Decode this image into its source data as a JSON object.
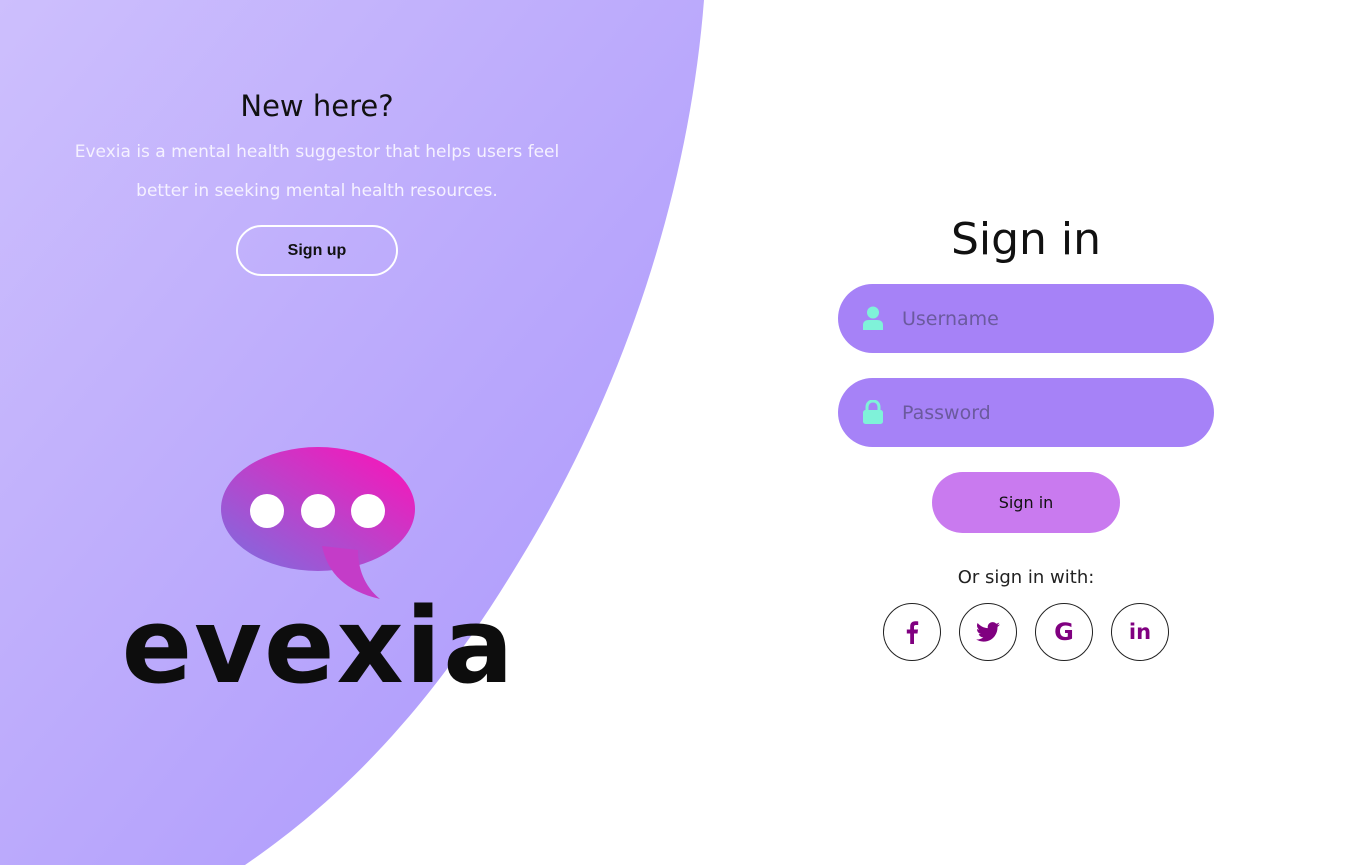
{
  "colors": {
    "panel_gradient_start": "#cdbffd",
    "panel_gradient_end": "#ab95fb",
    "field_bg": "#a682f7",
    "field_icon": "#7ff2d9",
    "signin_button": "#c97aef",
    "social_icon": "#800080",
    "logo_gradient_start": "#7a6fe0",
    "logo_gradient_end": "#ff10b8"
  },
  "left_panel": {
    "title": "New here?",
    "description": "Evexia is a mental health suggestor that helps users feel better in seeking mental health resources.",
    "signup_label": "Sign up"
  },
  "logo": {
    "wordmark": "evexia",
    "icon": "speech-bubble-icon"
  },
  "signin": {
    "title": "Sign in",
    "username_placeholder": "Username",
    "username_value": "",
    "username_icon": "user-icon",
    "password_placeholder": "Password",
    "password_value": "",
    "password_icon": "lock-icon",
    "button_label": "Sign in",
    "social_label": "Or sign in with:",
    "socials": [
      {
        "name": "facebook-icon",
        "glyph": "f"
      },
      {
        "name": "twitter-icon",
        "glyph": ""
      },
      {
        "name": "google-icon",
        "glyph": "G"
      },
      {
        "name": "linkedin-icon",
        "glyph": "in"
      }
    ]
  }
}
